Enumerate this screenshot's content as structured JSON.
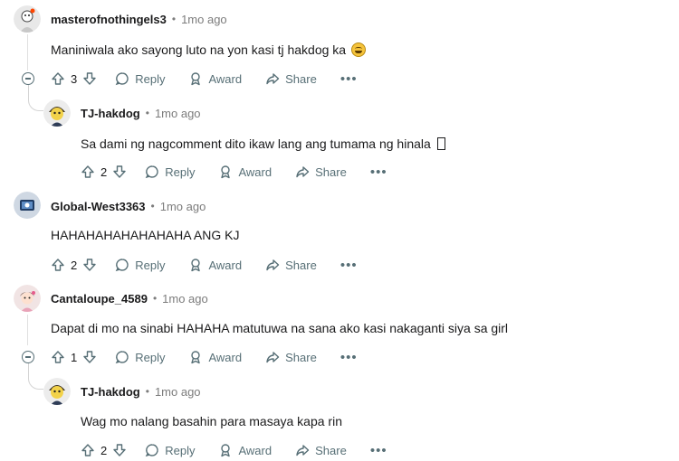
{
  "comments": [
    {
      "author": "masterofnothingels3",
      "time": "1mo ago",
      "text": "Maniniwala ako sayong luto na yon kasi tj hakdog ka",
      "emoji": "grinning-face-emoji",
      "votes": "3",
      "reply_label": "Reply",
      "award_label": "Award",
      "share_label": "Share",
      "more_label": "•••"
    },
    {
      "author": "TJ-hakdog",
      "time": "1mo ago",
      "text": "Sa dami ng nagcomment dito ikaw lang ang tumama ng hinala",
      "votes": "2",
      "reply_label": "Reply",
      "award_label": "Award",
      "share_label": "Share",
      "more_label": "•••"
    },
    {
      "author": "Global-West3363",
      "time": "1mo ago",
      "text": "HAHAHAHAHAHAHAHA ANG KJ",
      "votes": "2",
      "reply_label": "Reply",
      "award_label": "Award",
      "share_label": "Share",
      "more_label": "•••"
    },
    {
      "author": "Cantaloupe_4589",
      "time": "1mo ago",
      "text": "Dapat di mo na sinabi HAHAHA matutuwa na sana ako kasi nakaganti siya sa girl",
      "votes": "1",
      "reply_label": "Reply",
      "award_label": "Award",
      "share_label": "Share",
      "more_label": "•••"
    },
    {
      "author": "TJ-hakdog",
      "time": "1mo ago",
      "text": "Wag mo nalang basahin para masaya kapa rin",
      "votes": "2",
      "reply_label": "Reply",
      "award_label": "Award",
      "share_label": "Share",
      "more_label": "•••"
    }
  ],
  "separator": "•",
  "colors": {
    "text": "#1a1a1b",
    "meta": "#7c7c7c",
    "action": "#576f76"
  }
}
